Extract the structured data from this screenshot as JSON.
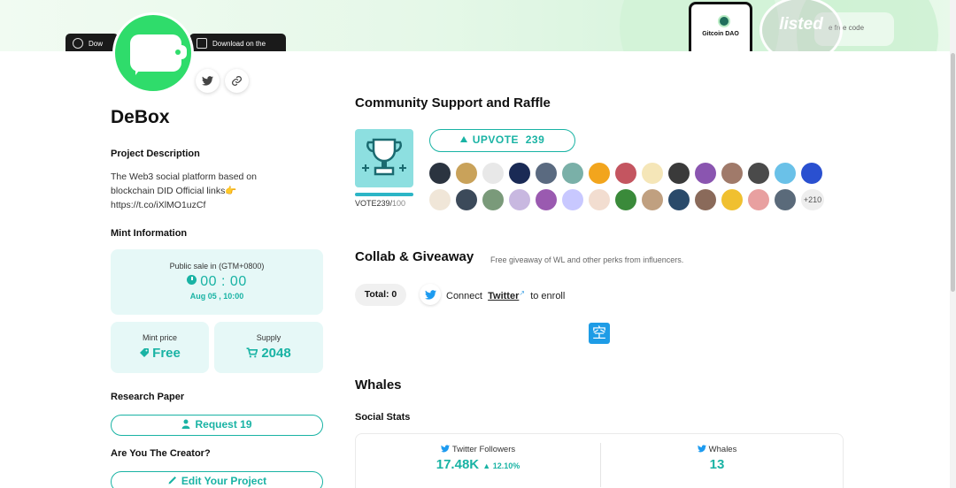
{
  "banner": {
    "store_left_label": "Dow",
    "store_right_label": "Download on the",
    "partner_name": "Gitcoin DAO",
    "qr_hint": "e free code",
    "badge_text": "listed"
  },
  "project": {
    "name": "DeBox",
    "description_heading": "Project Description",
    "description": "The Web3 social platform based on blockchain DID Official links👉 https://t.co/iXlMO1uzCf",
    "mint_heading": "Mint Information",
    "sale_label": "Public sale in (GTM+0800)",
    "countdown": "00 : 00",
    "sale_date": "Aug 05 , 10:00",
    "mint_price_label": "Mint price",
    "mint_price_value": "Free",
    "supply_label": "Supply",
    "supply_value": "2048",
    "research_heading": "Research Paper",
    "request_label": "Request 19",
    "creator_heading": "Are You The Creator?",
    "edit_label": "Edit Your Project"
  },
  "community": {
    "heading": "Community Support and Raffle",
    "upvote_label": "UPVOTE",
    "upvote_count": "239",
    "vote_current": "VOTE239/",
    "vote_max": "100",
    "progress": 1.0,
    "more_count": "+210",
    "voter_colors": [
      "#2b3440",
      "#c9a25a",
      "#e8e8e8",
      "#1a2a55",
      "#5a6a80",
      "#7ab0a8",
      "#f2a51d",
      "#c45560",
      "#f5e6b8",
      "#3a3a3a",
      "#8a55b0",
      "#a07a6a",
      "#4a4a4a",
      "#6ac1e8",
      "#2a50d0",
      "#f0e6d8",
      "#3c4a5a",
      "#7a9a7a",
      "#c8b8e0",
      "#9a5ab0",
      "#c8c8ff",
      "#f2ddd0",
      "#3a8a3a",
      "#c0a080",
      "#2a4a6a",
      "#8a6a5a",
      "#f0c030",
      "#e8a0a0",
      "#5a6a7a"
    ]
  },
  "collab": {
    "heading": "Collab & Giveaway",
    "subtitle": "Free giveaway of WL and other perks from influencers.",
    "total_label": "Total: 0",
    "connect_prefix": "Connect",
    "connect_link": "Twitter",
    "connect_suffix": "to enroll",
    "empty_glyph": "空"
  },
  "whales": {
    "heading": "Whales",
    "social_heading": "Social Stats",
    "twitter_followers_label": "Twitter Followers",
    "twitter_followers_value": "17.48K",
    "twitter_followers_change": "12.10%",
    "whales_label": "Whales",
    "whales_value": "13"
  },
  "colors": {
    "accent": "#19b3a4",
    "avatar": "#2fdc6b",
    "twitter": "#1d9bf0",
    "box_bg": "#e6f8f7"
  }
}
